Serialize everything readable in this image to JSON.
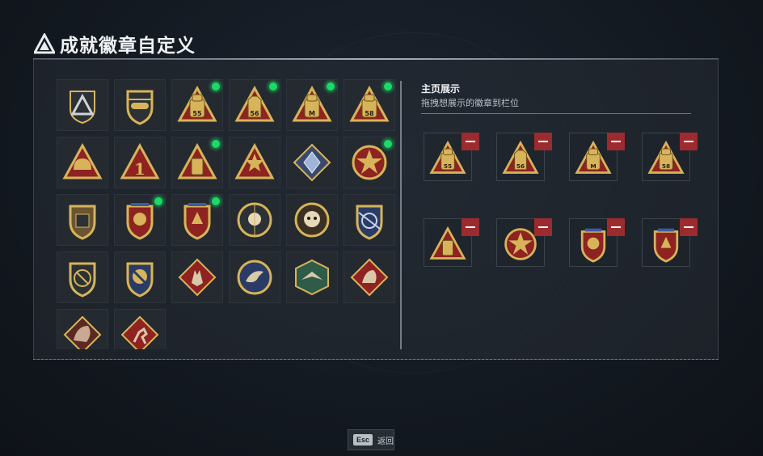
{
  "header": {
    "title": "成就徽章自定义",
    "logo_icon": "triangle-logo-icon"
  },
  "badges": [
    {
      "icon": "triangle-mountain-badge-icon",
      "new": false
    },
    {
      "icon": "helicopter-badge-icon",
      "new": false
    },
    {
      "icon": "backpack-55-badge-icon",
      "new": true
    },
    {
      "icon": "vest-56-badge-icon",
      "new": true
    },
    {
      "icon": "backpack-m-badge-icon",
      "new": true
    },
    {
      "icon": "backpack-58-badge-icon",
      "new": true
    },
    {
      "icon": "helmet-badge-icon",
      "new": false
    },
    {
      "icon": "number-one-badge-icon",
      "new": false
    },
    {
      "icon": "case-badge-icon",
      "new": true
    },
    {
      "icon": "soldiers-badge-icon",
      "new": false
    },
    {
      "icon": "crystal-badge-icon",
      "new": false
    },
    {
      "icon": "star-medal-badge-icon",
      "new": true
    },
    {
      "icon": "shield-emblem-badge-icon",
      "new": false
    },
    {
      "icon": "eagle-shield-badge-icon",
      "new": true
    },
    {
      "icon": "lion-shield-badge-icon",
      "new": true
    },
    {
      "icon": "skull-target-badge-icon",
      "new": false
    },
    {
      "icon": "skull-flower-badge-icon",
      "new": false
    },
    {
      "icon": "globe-rifles-badge-icon",
      "new": false
    },
    {
      "icon": "no-guns-badge-icon",
      "new": false
    },
    {
      "icon": "crest-badge-icon",
      "new": false
    },
    {
      "icon": "wolf-diamond-badge-icon",
      "new": false
    },
    {
      "icon": "eagle-head-badge-icon",
      "new": false
    },
    {
      "icon": "wings-hexagon-badge-icon",
      "new": false
    },
    {
      "icon": "dragon-diamond-badge-icon",
      "new": false
    },
    {
      "icon": "dragon-badge-icon",
      "new": false
    },
    {
      "icon": "runner-badge-icon",
      "new": false
    }
  ],
  "showcase": {
    "title": "主页展示",
    "subtitle": "拖拽想展示的徽章到栏位",
    "slots": [
      {
        "icon": "backpack-55-badge-icon"
      },
      {
        "icon": "vest-56-badge-icon"
      },
      {
        "icon": "backpack-m-badge-icon"
      },
      {
        "icon": "backpack-58-badge-icon"
      },
      {
        "icon": "case-badge-icon"
      },
      {
        "icon": "star-medal-badge-icon"
      },
      {
        "icon": "eagle-shield-badge-icon"
      },
      {
        "icon": "lion-shield-badge-icon"
      }
    ]
  },
  "footer": {
    "key": "Esc",
    "label": "返回"
  },
  "colors": {
    "accent_green": "#1fd86a",
    "remove_red": "#9b2b2e",
    "badge_gold": "#d7b45a",
    "badge_red": "#8e2322"
  }
}
